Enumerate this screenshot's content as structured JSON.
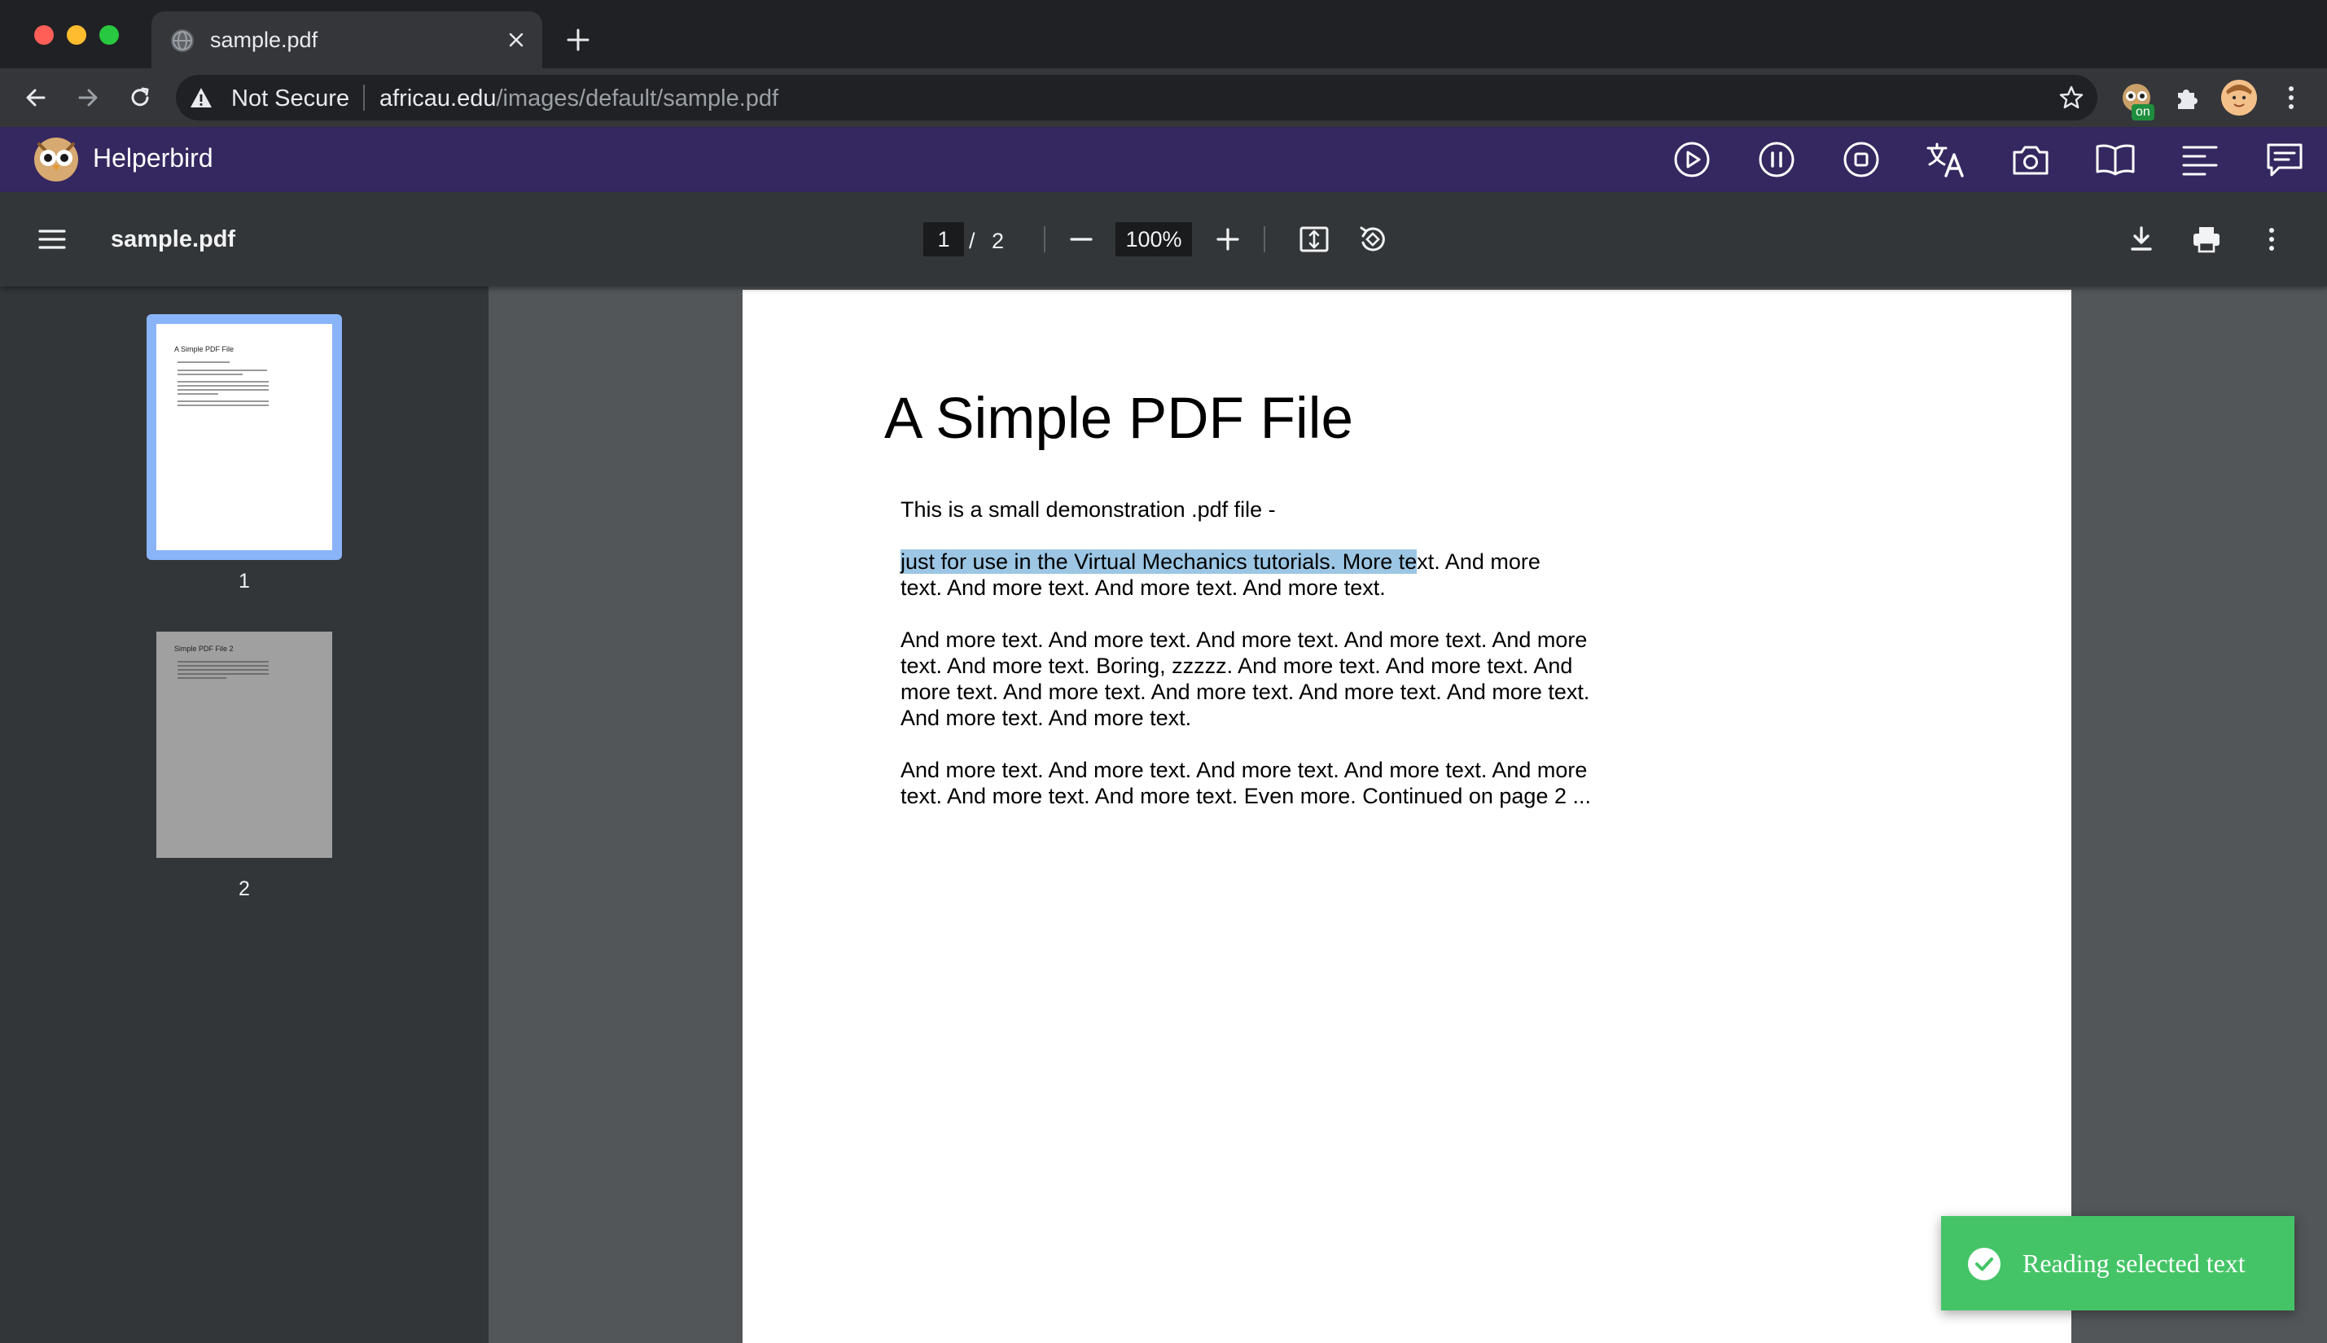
{
  "browser": {
    "tab": {
      "title": "sample.pdf",
      "favicon": "globe-icon"
    },
    "omnibox": {
      "security_label": "Not Secure",
      "url_host": "africau.edu",
      "url_path": "/images/default/sample.pdf"
    },
    "extension_badge": "on"
  },
  "helperbird": {
    "name": "Helperbird",
    "tools": [
      "play-icon",
      "pause-icon",
      "stop-icon",
      "translate-icon",
      "camera-icon",
      "book-icon",
      "align-icon",
      "comment-icon"
    ],
    "accent": "#35275f"
  },
  "pdf_viewer": {
    "file_name": "sample.pdf",
    "current_page": "1",
    "page_separator": "/",
    "total_pages": "2",
    "zoom": "100%"
  },
  "thumbnails": [
    {
      "label": "1",
      "mini_title": "A Simple PDF File",
      "selected": true
    },
    {
      "label": "2",
      "mini_title": "Simple PDF File 2",
      "selected": false
    }
  ],
  "document": {
    "title": "A Simple PDF File",
    "para1": "This is a small demonstration .pdf file -",
    "para2_highlight": "just for use in the Virtual Mechanics tutorials. More te",
    "para2_rest_line1": "xt. And more",
    "para2_line2": "text. And more text. And more text. And more text.",
    "para3_lines": [
      "And more text. And more text. And more text. And more text. And more",
      "text. And more text. Boring, zzzzz. And more text. And more text. And",
      "more text. And more text. And more text. And more text. And more text.",
      "And more text. And more text."
    ],
    "para4_lines": [
      "And more text. And more text. And more text. And more text. And more",
      "text. And more text. And more text. Even more. Continued on page 2 ..."
    ]
  },
  "toast": {
    "message": "Reading selected text",
    "color": "#45c467"
  }
}
